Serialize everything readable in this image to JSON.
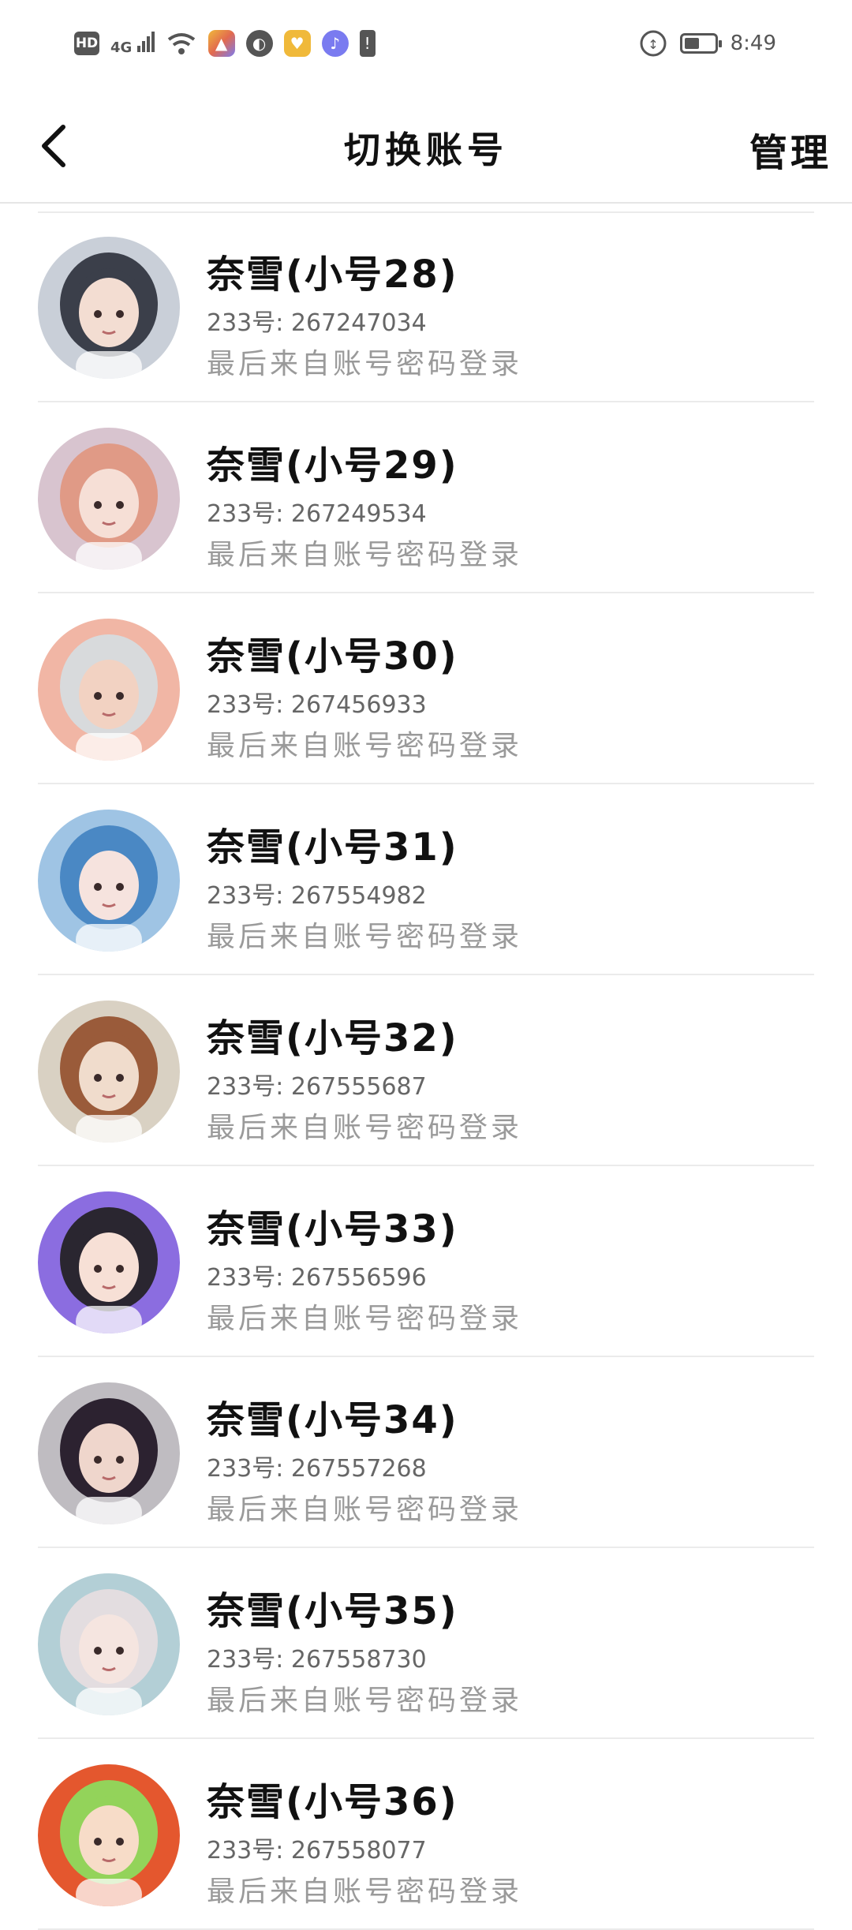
{
  "status_bar": {
    "hd_badge": "HD",
    "network": "4G",
    "time": "8:49",
    "icons": [
      "hd-icon",
      "signal-4g-icon",
      "wifi-icon",
      "app-icon",
      "app-icon",
      "app-icon",
      "music-icon",
      "alert-icon",
      "battery-icon"
    ],
    "colors": {
      "accent_1": "#f0b93a",
      "accent_2": "#7a7bf0",
      "accent_3": "#e26a4f"
    }
  },
  "header": {
    "title": "切换账号",
    "manage_label": "管理",
    "back_icon": "chevron-left-icon"
  },
  "accounts": [
    {
      "name": "奈雪(小号28)",
      "uid_label": "233号:",
      "uid": "267247034",
      "login_method": "最后来自账号密码登录"
    },
    {
      "name": "奈雪(小号29)",
      "uid_label": "233号:",
      "uid": "267249534",
      "login_method": "最后来自账号密码登录"
    },
    {
      "name": "奈雪(小号30)",
      "uid_label": "233号:",
      "uid": "267456933",
      "login_method": "最后来自账号密码登录"
    },
    {
      "name": "奈雪(小号31)",
      "uid_label": "233号:",
      "uid": "267554982",
      "login_method": "最后来自账号密码登录"
    },
    {
      "name": "奈雪(小号32)",
      "uid_label": "233号:",
      "uid": "267555687",
      "login_method": "最后来自账号密码登录"
    },
    {
      "name": "奈雪(小号33)",
      "uid_label": "233号:",
      "uid": "267556596",
      "login_method": "最后来自账号密码登录"
    },
    {
      "name": "奈雪(小号34)",
      "uid_label": "233号:",
      "uid": "267557268",
      "login_method": "最后来自账号密码登录"
    },
    {
      "name": "奈雪(小号35)",
      "uid_label": "233号:",
      "uid": "267558730",
      "login_method": "最后来自账号密码登录"
    },
    {
      "name": "奈雪(小号36)",
      "uid_label": "233号:",
      "uid": "267558077",
      "login_method": "最后来自账号密码登录"
    }
  ],
  "avatar_colors": [
    {
      "bg": "#c9cfd8",
      "hair": "#3b3f4a",
      "skin": "#f3ddd2"
    },
    {
      "bg": "#d8c4cf",
      "hair": "#e09a86",
      "skin": "#f6dfd6"
    },
    {
      "bg": "#f1b6a5",
      "hair": "#d8dadc",
      "skin": "#f2d2c2"
    },
    {
      "bg": "#9fc4e4",
      "hair": "#4a88c4",
      "skin": "#f6e3de"
    },
    {
      "bg": "#d9d1c3",
      "hair": "#9a5b3a",
      "skin": "#f0dccc"
    },
    {
      "bg": "#8b6de0",
      "hair": "#2a2630",
      "skin": "#f7e0d6"
    },
    {
      "bg": "#bfbcc1",
      "hair": "#2c2230",
      "skin": "#efd6cc"
    },
    {
      "bg": "#b3cfd6",
      "hair": "#e3dde0",
      "skin": "#f5e5e0"
    },
    {
      "bg": "#e4572e",
      "hair": "#93d35a",
      "skin": "#f7dcc8"
    }
  ]
}
